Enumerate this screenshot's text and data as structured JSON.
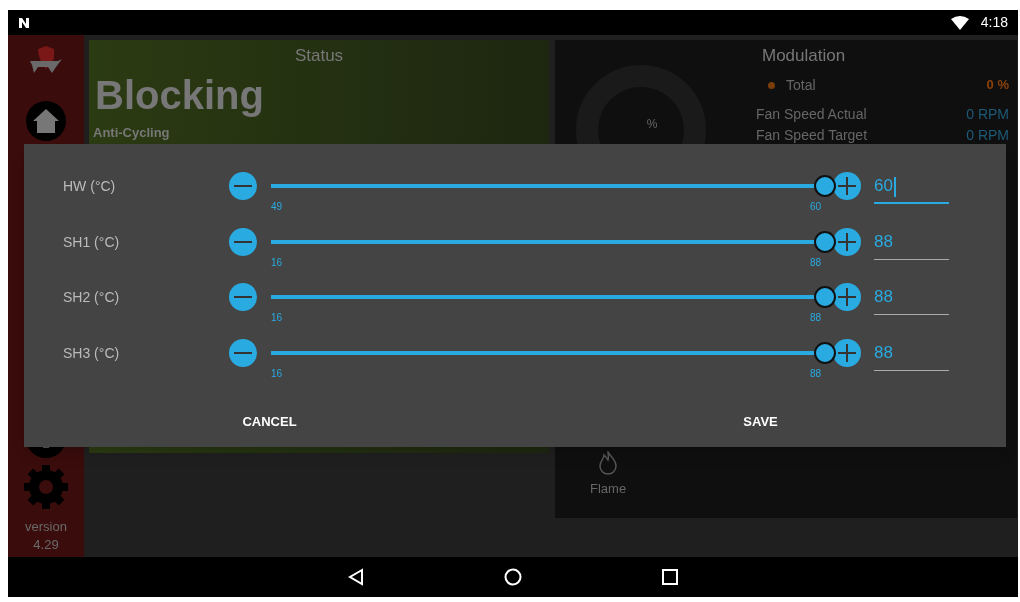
{
  "status_bar": {
    "time": "4:18"
  },
  "sidebar": {
    "version_label": "version",
    "version": "4.29"
  },
  "status_card": {
    "title": "Status",
    "state": "Blocking",
    "detail": "Anti-Cycling"
  },
  "modulation_card": {
    "gauge_unit": "%",
    "title": "Modulation",
    "total_label": "Total",
    "total_value": "0 %",
    "fan_rows": [
      {
        "label": "Fan Speed Actual",
        "value": "0 RPM"
      },
      {
        "label": "Fan Speed Target",
        "value": "0 RPM"
      }
    ],
    "flame_label": "Flame"
  },
  "dialog": {
    "rows": [
      {
        "label": "HW (°C)",
        "min": "49",
        "max": "60",
        "level": 1,
        "value": "60",
        "focused": true
      },
      {
        "label": "SH1 (°C)",
        "min": "16",
        "max": "88",
        "level": 1,
        "value": "88",
        "focused": false
      },
      {
        "label": "SH2 (°C)",
        "min": "16",
        "max": "88",
        "level": 1,
        "value": "88",
        "focused": false
      },
      {
        "label": "SH3 (°C)",
        "min": "16",
        "max": "88",
        "level": 1,
        "value": "88",
        "focused": false
      }
    ],
    "buttons": [
      "CANCEL",
      "SAVE"
    ]
  }
}
